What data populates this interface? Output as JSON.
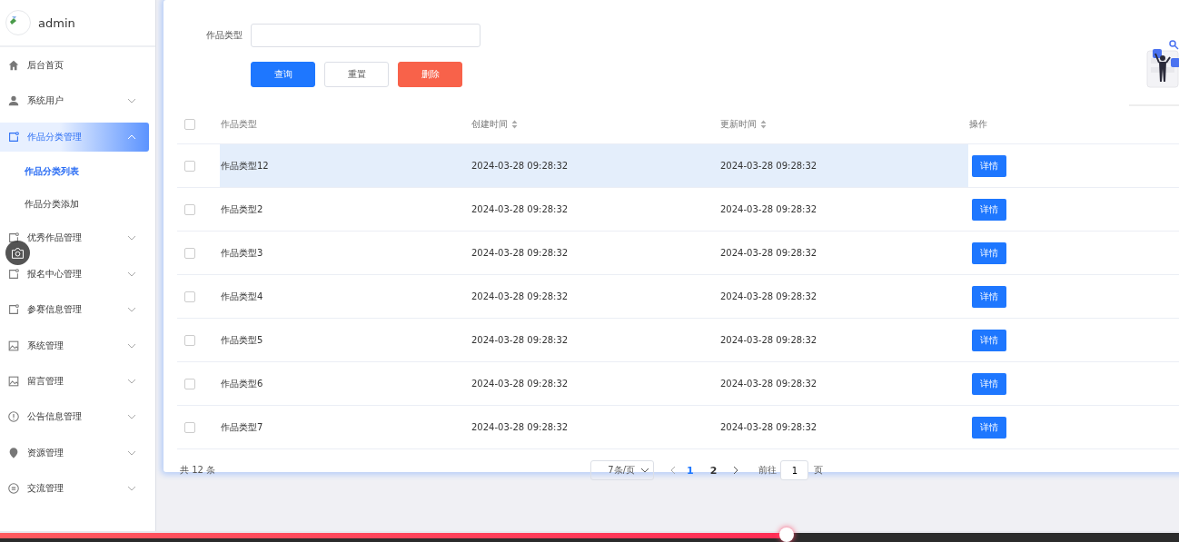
{
  "sidebar": {
    "user": "admin",
    "items": [
      {
        "label": "后台首页",
        "selected": false
      },
      {
        "label": "系统用户",
        "selected": false,
        "expanded": false
      },
      {
        "label": "作品分类管理",
        "selected": true,
        "expanded": true,
        "children": [
          {
            "label": "作品分类列表",
            "selected": true
          },
          {
            "label": "作品分类添加",
            "selected": false
          }
        ]
      },
      {
        "label": "优秀作品管理",
        "selected": false,
        "expanded": false
      },
      {
        "label": "报名中心管理",
        "selected": false,
        "expanded": false
      },
      {
        "label": "参赛信息管理",
        "selected": false,
        "expanded": false
      },
      {
        "label": "系统管理",
        "selected": false,
        "expanded": false
      },
      {
        "label": "留言管理",
        "selected": false,
        "expanded": false
      },
      {
        "label": "公告信息管理",
        "selected": false,
        "expanded": false
      },
      {
        "label": "资源管理",
        "selected": false,
        "expanded": false
      },
      {
        "label": "交流管理",
        "selected": false,
        "expanded": false
      }
    ]
  },
  "search": {
    "label": "作品类型",
    "buttons": [
      {
        "label": "查询",
        "kind": "primary"
      },
      {
        "label": "重置",
        "kind": "default"
      },
      {
        "label": "删除",
        "kind": "danger"
      }
    ]
  },
  "table": {
    "header_checked": false,
    "columns": [
      {
        "label": "作品类型",
        "sortable": false
      },
      {
        "label": "创建时间",
        "sortable": true
      },
      {
        "label": "更新时间",
        "sortable": true
      },
      {
        "label": "操作",
        "sortable": false
      }
    ],
    "rows": [
      {
        "checked": false,
        "hovered": true,
        "cells": [
          "作品类型12",
          "2024-03-28 09:28:32",
          "2024-03-28 09:28:32"
        ],
        "action": "详情"
      },
      {
        "checked": false,
        "hovered": false,
        "cells": [
          "作品类型2",
          "2024-03-28 09:28:32",
          "2024-03-28 09:28:32"
        ],
        "action": "详情"
      },
      {
        "checked": false,
        "hovered": false,
        "cells": [
          "作品类型3",
          "2024-03-28 09:28:32",
          "2024-03-28 09:28:32"
        ],
        "action": "详情"
      },
      {
        "checked": false,
        "hovered": false,
        "cells": [
          "作品类型4",
          "2024-03-28 09:28:32",
          "2024-03-28 09:28:32"
        ],
        "action": "详情"
      },
      {
        "checked": false,
        "hovered": false,
        "cells": [
          "作品类型5",
          "2024-03-28 09:28:32",
          "2024-03-28 09:28:32"
        ],
        "action": "详情"
      },
      {
        "checked": false,
        "hovered": false,
        "cells": [
          "作品类型6",
          "2024-03-28 09:28:32",
          "2024-03-28 09:28:32"
        ],
        "action": "详情"
      },
      {
        "checked": false,
        "hovered": false,
        "cells": [
          "作品类型7",
          "2024-03-28 09:28:32",
          "2024-03-28 09:28:32"
        ],
        "action": "详情"
      }
    ]
  },
  "pagination": {
    "total": "共 12 条",
    "page_size": "7条/页",
    "pages": [
      {
        "label": "1",
        "selected": true
      },
      {
        "label": "2",
        "selected": false
      }
    ],
    "goto_label": "前往",
    "goto_value": "1",
    "goto_suffix": "页"
  },
  "video": {
    "level": 0.667
  }
}
